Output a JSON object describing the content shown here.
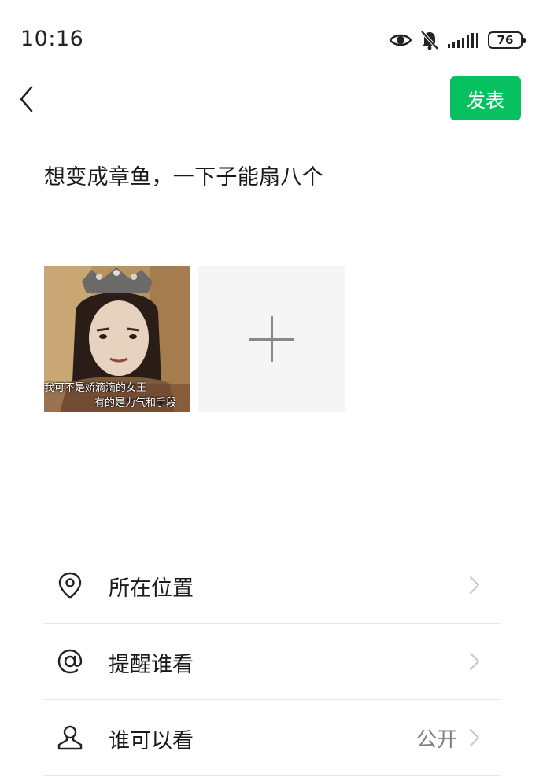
{
  "status_bar": {
    "time": "10:16",
    "battery": "76",
    "icons": [
      "eye-icon",
      "bell-off-icon",
      "signal-icon",
      "battery-icon"
    ]
  },
  "header": {
    "back_icon": "chevron-left-icon",
    "publish_label": "发表",
    "publish_color": "#07c160"
  },
  "post": {
    "text": "想变成章鱼，一下子能扇八个"
  },
  "images": {
    "photo": {
      "caption_line1": "我可不是娇滴滴的女王",
      "caption_line2": "有的是力气和手段"
    },
    "add_icon": "plus-icon"
  },
  "options": [
    {
      "icon": "location-pin-icon",
      "label": "所在位置",
      "value": ""
    },
    {
      "icon": "at-sign-icon",
      "label": "提醒谁看",
      "value": ""
    },
    {
      "icon": "person-icon",
      "label": "谁可以看",
      "value": "公开"
    }
  ]
}
